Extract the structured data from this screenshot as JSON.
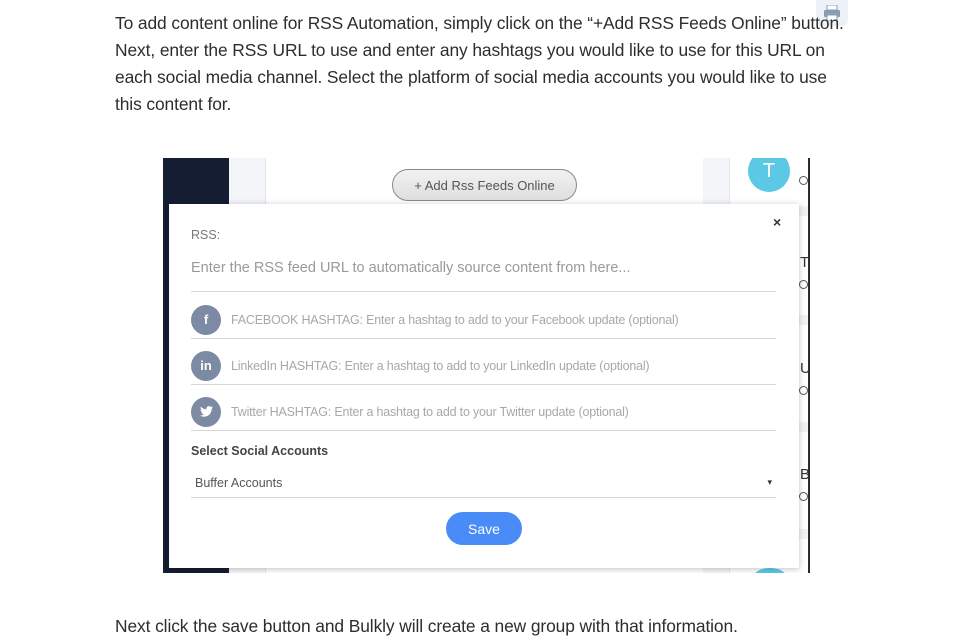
{
  "article": {
    "intro": "To add content online for RSS Automation, simply click on the “+Add RSS Feeds Online” button. Next, enter the RSS URL to use and enter any hashtags you would like to use for this URL on each social media channel. Select the platform of social media accounts you would like to use this content for.",
    "outro": "Next click the save button and Bulkly will create a new group with that information."
  },
  "icons": {
    "print": "printer-icon",
    "close": "close-icon",
    "facebook": "facebook-icon",
    "linkedin": "linkedin-icon",
    "twitter": "twitter-icon",
    "clock": "clock-icon",
    "caret": "chevron-down-icon"
  },
  "screenshot": {
    "add_button": "+ Add Rss Feeds Online",
    "avatar_letter": "T",
    "right_letters": [
      "T",
      "U",
      "B"
    ],
    "modal": {
      "close": "×",
      "rss_label": "RSS:",
      "rss_placeholder": "Enter the RSS feed URL to automatically source content from here...",
      "facebook_glyph": "f",
      "facebook_placeholder": "FACEBOOK HASHTAG: Enter a hashtag to add to your Facebook update (optional)",
      "linkedin_glyph": "in",
      "linkedin_placeholder": "LinkedIn HASHTAG: Enter a hashtag to add to your LinkedIn update (optional)",
      "twitter_glyph": "♥",
      "twitter_placeholder": "Twitter HASHTAG: Enter a hashtag to add to your Twitter update (optional)",
      "select_label": "Select Social Accounts",
      "select_value": "Buffer Accounts",
      "caret": "▾",
      "save": "Save"
    }
  },
  "colors": {
    "save_button": "#4a8cf7",
    "avatar": "#5bc8e6",
    "sidebar": "#151d33",
    "social_icon": "#7d8aa3"
  }
}
